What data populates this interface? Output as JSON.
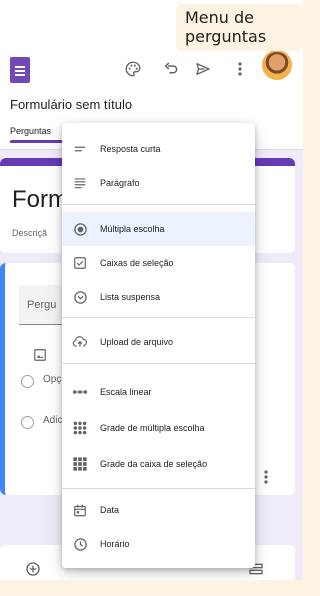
{
  "callout": {
    "text": "Menu de perguntas"
  },
  "app": {
    "document_title": "Formulário sem título",
    "tab": "Perguntas",
    "toolbar_icons": [
      "palette-icon",
      "undo-icon",
      "send-icon",
      "more-vert-icon"
    ],
    "avatar": "user-avatar"
  },
  "form": {
    "title_partial": "Form",
    "description_partial": "Descriçã"
  },
  "question": {
    "title_partial": "Pergu",
    "options": [
      {
        "text": "Opçã"
      },
      {
        "text": "Adic"
      }
    ]
  },
  "menu": {
    "items": [
      {
        "label": "Resposta curta",
        "icon": "short-answer-icon"
      },
      {
        "label": "Parágrafo",
        "icon": "paragraph-icon"
      },
      {
        "label": "Múltipla escolha",
        "icon": "radio-icon",
        "selected": true
      },
      {
        "label": "Caixas de seleção",
        "icon": "checkbox-icon"
      },
      {
        "label": "Lista suspensa",
        "icon": "dropdown-icon"
      },
      {
        "label": "Upload de arquivo",
        "icon": "cloud-upload-icon"
      },
      {
        "label": "Escala linear",
        "icon": "linear-scale-icon"
      },
      {
        "label": "Grade de múltipla escolha",
        "icon": "grid-dots-icon"
      },
      {
        "label": "Grade da caixa de seleção",
        "icon": "grid-squares-icon"
      },
      {
        "label": "Data",
        "icon": "calendar-icon"
      },
      {
        "label": "Horário",
        "icon": "clock-icon"
      }
    ]
  },
  "colors": {
    "accent": "#673ab7",
    "selected_bg": "#ecf3fe",
    "focus_bar": "#4285f4",
    "backdrop": "#f0ebf8",
    "callout_bg": "#fdf3e3"
  }
}
